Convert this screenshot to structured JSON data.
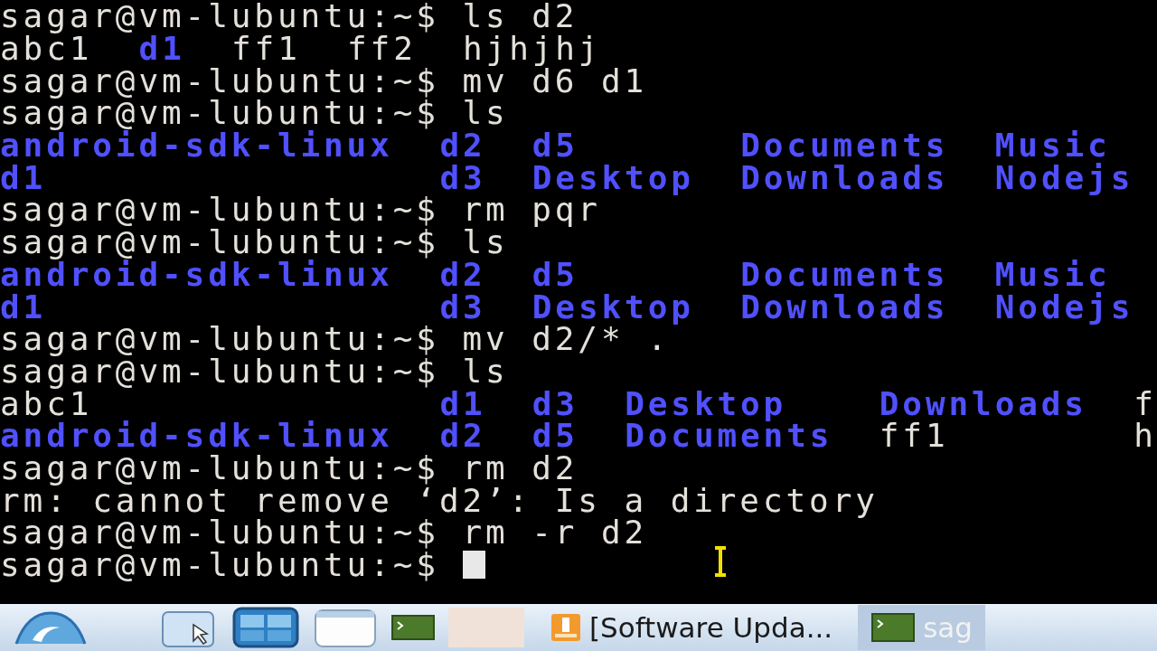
{
  "terminal": {
    "lines": [
      {
        "kind": "prompt",
        "prompt": "sagar@vm-lubuntu:~$",
        "command": "ls d2"
      },
      {
        "kind": "listing",
        "columns": [
          [
            {
              "text": "abc1",
              "kind": "file"
            }
          ],
          [
            {
              "text": "d1",
              "kind": "dir"
            }
          ],
          [
            {
              "text": "ff1",
              "kind": "file"
            }
          ],
          [
            {
              "text": "ff2",
              "kind": "file"
            }
          ],
          [
            {
              "text": "hjhjhj",
              "kind": "file"
            }
          ]
        ]
      },
      {
        "kind": "prompt",
        "prompt": "sagar@vm-lubuntu:~$",
        "command": "mv d6 d1"
      },
      {
        "kind": "prompt",
        "prompt": "sagar@vm-lubuntu:~$",
        "command": "ls"
      },
      {
        "kind": "listing",
        "columns": [
          [
            {
              "text": "android-sdk-linux",
              "kind": "dir"
            },
            {
              "text": "d1",
              "kind": "dir"
            }
          ],
          [
            {
              "text": "d2",
              "kind": "dir"
            },
            {
              "text": "d3",
              "kind": "dir"
            }
          ],
          [
            {
              "text": "d5",
              "kind": "dir"
            },
            {
              "text": "Desktop",
              "kind": "dir"
            }
          ],
          [
            {
              "text": "Documents",
              "kind": "dir"
            },
            {
              "text": "Downloads",
              "kind": "dir"
            }
          ],
          [
            {
              "text": "Music",
              "kind": "dir"
            },
            {
              "text": "Nodejs",
              "kind": "dir"
            }
          ]
        ]
      },
      {
        "kind": "prompt",
        "prompt": "sagar@vm-lubuntu:~$",
        "command": "rm pqr"
      },
      {
        "kind": "prompt",
        "prompt": "sagar@vm-lubuntu:~$",
        "command": "ls"
      },
      {
        "kind": "listing",
        "columns": [
          [
            {
              "text": "android-sdk-linux",
              "kind": "dir"
            },
            {
              "text": "d1",
              "kind": "dir"
            }
          ],
          [
            {
              "text": "d2",
              "kind": "dir"
            },
            {
              "text": "d3",
              "kind": "dir"
            }
          ],
          [
            {
              "text": "d5",
              "kind": "dir"
            },
            {
              "text": "Desktop",
              "kind": "dir"
            }
          ],
          [
            {
              "text": "Documents",
              "kind": "dir"
            },
            {
              "text": "Downloads",
              "kind": "dir"
            }
          ],
          [
            {
              "text": "Music",
              "kind": "dir"
            },
            {
              "text": "Nodejs",
              "kind": "dir"
            }
          ]
        ]
      },
      {
        "kind": "prompt",
        "prompt": "sagar@vm-lubuntu:~$",
        "command": "mv d2/* ."
      },
      {
        "kind": "prompt",
        "prompt": "sagar@vm-lubuntu:~$",
        "command": "ls"
      },
      {
        "kind": "listing",
        "columns": [
          [
            {
              "text": "abc1",
              "kind": "file"
            },
            {
              "text": "android-sdk-linux",
              "kind": "dir"
            }
          ],
          [
            {
              "text": "d1",
              "kind": "dir"
            },
            {
              "text": "d2",
              "kind": "dir"
            }
          ],
          [
            {
              "text": "d3",
              "kind": "dir"
            },
            {
              "text": "d5",
              "kind": "dir"
            }
          ],
          [
            {
              "text": "Desktop",
              "kind": "dir"
            },
            {
              "text": "Documents",
              "kind": "dir"
            }
          ],
          [
            {
              "text": "Downloads",
              "kind": "dir"
            },
            {
              "text": "ff1",
              "kind": "file"
            }
          ],
          [
            {
              "text": "f",
              "kind": "file"
            },
            {
              "text": "h",
              "kind": "file"
            }
          ]
        ]
      },
      {
        "kind": "prompt",
        "prompt": "sagar@vm-lubuntu:~$",
        "command": "rm d2"
      },
      {
        "kind": "output",
        "text": "rm: cannot remove ‘d2’: Is a directory"
      },
      {
        "kind": "prompt",
        "prompt": "sagar@vm-lubuntu:~$",
        "command": "rm -r d2"
      },
      {
        "kind": "prompt",
        "prompt": "sagar@vm-lubuntu:~$",
        "cursor": true
      }
    ]
  },
  "taskbar": {
    "tasks": [
      {
        "kind": "update",
        "label": "[Software Upda...",
        "selected": false
      },
      {
        "kind": "terminal",
        "label": "sag",
        "selected": true
      }
    ]
  }
}
